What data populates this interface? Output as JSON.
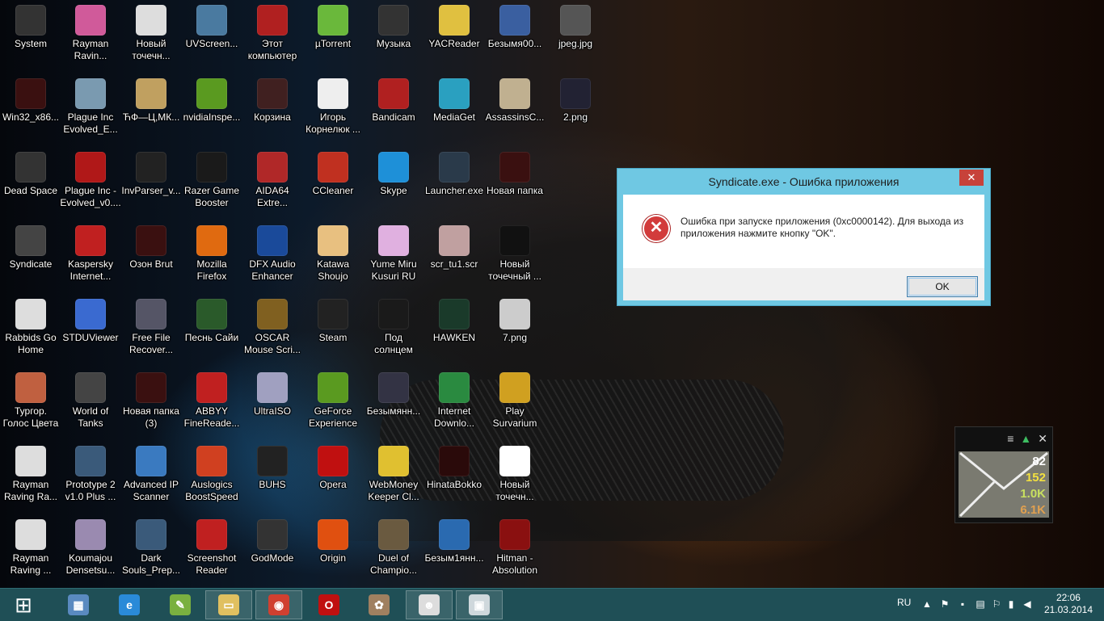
{
  "desktop_icons": [
    {
      "label": "System",
      "icon": "system-icon",
      "color": "#333"
    },
    {
      "label": "Rayman\nRavin...",
      "icon": "rayman-icon",
      "color": "#d05a9a"
    },
    {
      "label": "Новый\nточечн...",
      "icon": "image-file-icon",
      "color": "#ddd"
    },
    {
      "label": "UVScreen...",
      "icon": "screen-recorder-icon",
      "color": "#4a7aa0"
    },
    {
      "label": "Этот\nкомпьютер",
      "icon": "computer-icon",
      "color": "#b02020"
    },
    {
      "label": "µTorrent",
      "icon": "utorrent-icon",
      "color": "#6ab83b"
    },
    {
      "label": "Музыка",
      "icon": "music-folder-icon",
      "color": "#333"
    },
    {
      "label": "YACReader",
      "icon": "speech-bubble-icon",
      "color": "#e0c040"
    },
    {
      "label": "Безымя00...",
      "icon": "image-file-icon",
      "color": "#3a5fa0"
    },
    {
      "label": "jpeg.jpg",
      "icon": "image-file-icon",
      "color": "#555"
    },
    {
      "label": "Win32_x86...",
      "icon": "folder-red-icon",
      "color": "#3a1010"
    },
    {
      "label": "Plague Inc\nEvolved_E...",
      "icon": "plague-icon",
      "color": "#7a9ab0"
    },
    {
      "label": "ЋФ—Ц,МК...",
      "icon": "gear-icon",
      "color": "#c0a060"
    },
    {
      "label": "nvidiaInspe...",
      "icon": "nvidia-icon",
      "color": "#5a9a20"
    },
    {
      "label": "Корзина",
      "icon": "recycle-bin-icon",
      "color": "#402020"
    },
    {
      "label": "Игорь\nКорнелюк ...",
      "icon": "mp3-file-icon",
      "color": "#eee"
    },
    {
      "label": "Bandicam",
      "icon": "bandicam-icon",
      "color": "#b02020"
    },
    {
      "label": "MediaGet",
      "icon": "download-icon",
      "color": "#2aa0c0"
    },
    {
      "label": "AssassinsC...",
      "icon": "assassin-icon",
      "color": "#c0b090"
    },
    {
      "label": "2.png",
      "icon": "image-file-icon",
      "color": "#223"
    },
    {
      "label": "Dead Space",
      "icon": "dead-space-icon",
      "color": "#333"
    },
    {
      "label": "Plague Inc -\nEvolved_v0....",
      "icon": "biohazard-icon",
      "color": "#b01818"
    },
    {
      "label": "InvParser_v...",
      "icon": "letter-a-icon",
      "color": "#222"
    },
    {
      "label": "Razer Game\nBooster",
      "icon": "razer-icon",
      "color": "#1a1a1a"
    },
    {
      "label": "AIDA64\nExtre...",
      "icon": "aida64-icon",
      "color": "#b02828"
    },
    {
      "label": "CCleaner",
      "icon": "ccleaner-icon",
      "color": "#c03020"
    },
    {
      "label": "Skype",
      "icon": "skype-icon",
      "color": "#1e90d8"
    },
    {
      "label": "Launcher.exe",
      "icon": "exe-icon",
      "color": "#2a3a4a"
    },
    {
      "label": "Новая папка",
      "icon": "folder-red-icon",
      "color": "#3a1010"
    },
    {
      "label": "",
      "icon": "",
      "color": ""
    },
    {
      "label": "Syndicate",
      "icon": "syndicate-icon",
      "color": "#444"
    },
    {
      "label": "Kaspersky\nInternet...",
      "icon": "kaspersky-icon",
      "color": "#c02020"
    },
    {
      "label": "Озон Brut",
      "icon": "folder-red-icon",
      "color": "#3a1010"
    },
    {
      "label": "Mozilla\nFirefox",
      "icon": "firefox-icon",
      "color": "#e06a10"
    },
    {
      "label": "DFX Audio\nEnhancer",
      "icon": "dfx-icon",
      "color": "#1a4a9a"
    },
    {
      "label": "Katawa\nShoujo",
      "icon": "heart-icon",
      "color": "#e8c080"
    },
    {
      "label": "Yume Miru\nKusuri RU",
      "icon": "heart-icon",
      "color": "#e0b0e0"
    },
    {
      "label": "scr_tu1.scr",
      "icon": "anime-image-icon",
      "color": "#c0a0a0"
    },
    {
      "label": "Новый\nточечный ...",
      "icon": "image-file-icon",
      "color": "#111"
    },
    {
      "label": "",
      "icon": "",
      "color": ""
    },
    {
      "label": "Rabbids Go\nHome",
      "icon": "rabbids-icon",
      "color": "#ddd"
    },
    {
      "label": "STDUViewer",
      "icon": "magnifier-icon",
      "color": "#3a6ad0"
    },
    {
      "label": "Free File\nRecover...",
      "icon": "film-icon",
      "color": "#556"
    },
    {
      "label": "Песнь Сайи",
      "icon": "eye-icon",
      "color": "#2a5a2a"
    },
    {
      "label": "OSCAR\nMouse Scri...",
      "icon": "oscar-icon",
      "color": "#806020"
    },
    {
      "label": "Steam",
      "icon": "steam-icon",
      "color": "#222"
    },
    {
      "label": "Под\nсолнцем",
      "icon": "folder-red-icon",
      "color": "#1a1a1a"
    },
    {
      "label": "HAWKEN",
      "icon": "hawken-icon",
      "color": "#1a3a2a"
    },
    {
      "label": "7.png",
      "icon": "image-file-icon",
      "color": "#ccc"
    },
    {
      "label": "",
      "icon": "",
      "color": ""
    },
    {
      "label": "Тургор.\nГолос Цвета",
      "icon": "turgor-icon",
      "color": "#c06040"
    },
    {
      "label": "World of\nTanks",
      "icon": "wot-icon",
      "color": "#444"
    },
    {
      "label": "Новая папка\n(3)",
      "icon": "folder-red-icon",
      "color": "#3a1010"
    },
    {
      "label": "ABBYY\nFineReade...",
      "icon": "abbyy-icon",
      "color": "#c02020"
    },
    {
      "label": "UltraISO",
      "icon": "disc-icon",
      "color": "#a0a0c0"
    },
    {
      "label": "GeForce\nExperience",
      "icon": "nvidia-icon",
      "color": "#5a9a20"
    },
    {
      "label": "Безымянн...",
      "icon": "image-file-icon",
      "color": "#334"
    },
    {
      "label": "Internet\nDownlo...",
      "icon": "idm-icon",
      "color": "#2a8a40"
    },
    {
      "label": "Play\nSurvarium",
      "icon": "radiation-icon",
      "color": "#d0a020"
    },
    {
      "label": "",
      "icon": "",
      "color": ""
    },
    {
      "label": "Rayman\nRaving Ra...",
      "icon": "rayman-icon",
      "color": "#ddd"
    },
    {
      "label": "Prototype 2\nv1.0 Plus ...",
      "icon": "trainer-icon",
      "color": "#3a5a7a"
    },
    {
      "label": "Advanced IP\nScanner",
      "icon": "network-icon",
      "color": "#3a7ac0"
    },
    {
      "label": "Auslogics\nBoostSpeed",
      "icon": "speedometer-icon",
      "color": "#d04020"
    },
    {
      "label": "BUHS",
      "icon": "folder-red-icon",
      "color": "#222"
    },
    {
      "label": "Opera",
      "icon": "opera-icon",
      "color": "#c01010"
    },
    {
      "label": "WebMoney\nKeeper Cl...",
      "icon": "webmoney-icon",
      "color": "#e0c030"
    },
    {
      "label": "HinataBokko",
      "icon": "folder-red-icon",
      "color": "#2a0a0a"
    },
    {
      "label": "Новый\nточечн...",
      "icon": "image-file-icon",
      "color": "#fff"
    },
    {
      "label": "",
      "icon": "",
      "color": ""
    },
    {
      "label": "Rayman\nRaving ...",
      "icon": "rayman-icon",
      "color": "#ddd"
    },
    {
      "label": "Koumajou\nDensetsu...",
      "icon": "anime-image-icon",
      "color": "#9a8ab0"
    },
    {
      "label": "Dark\nSouls_Prep...",
      "icon": "trainer-icon",
      "color": "#3a5a7a"
    },
    {
      "label": "Screenshot\nReader",
      "icon": "screenshot-icon",
      "color": "#c02020"
    },
    {
      "label": "GodMode",
      "icon": "godmode-icon",
      "color": "#333"
    },
    {
      "label": "Origin",
      "icon": "origin-icon",
      "color": "#e05010"
    },
    {
      "label": "Duel of\nChampio...",
      "icon": "game-icon",
      "color": "#6a5a40"
    },
    {
      "label": "Безым1янн...",
      "icon": "image-file-icon",
      "color": "#2a6ab0"
    },
    {
      "label": "Hitman -\nAbsolution",
      "icon": "hitman-icon",
      "color": "#8a1010"
    },
    {
      "label": "",
      "icon": "",
      "color": ""
    }
  ],
  "dialog": {
    "title": "Syndicate.exe - Ошибка приложения",
    "close_label": "✕",
    "error_glyph": "✕",
    "message": "Ошибка при запуске приложения (0xc0000142). Для выхода из приложения нажмите кнопку \"OK\".",
    "ok_label": "OK"
  },
  "gadget": {
    "menu_glyph": "≡",
    "up_glyph": "▲",
    "close_glyph": "✕",
    "values": [
      {
        "text": "82",
        "color": "#ffffff"
      },
      {
        "text": "152",
        "color": "#f2e040"
      },
      {
        "text": "1.0K",
        "color": "#c8e060"
      },
      {
        "text": "6.1K",
        "color": "#e0a050"
      }
    ]
  },
  "taskbar": {
    "apps": [
      {
        "name": "taskbar-windows-logo",
        "icon": "windows-logo-icon",
        "glyph": "⊞",
        "color": "transparent",
        "active": false
      },
      {
        "name": "taskbar-calculator",
        "icon": "calculator-icon",
        "glyph": "▦",
        "color": "#5a8ac0",
        "active": false
      },
      {
        "name": "taskbar-internet-explorer",
        "icon": "internet-explorer-icon",
        "glyph": "e",
        "color": "#2a8ad8",
        "active": false
      },
      {
        "name": "taskbar-notepad",
        "icon": "notepad-icon",
        "glyph": "✎",
        "color": "#7ab040",
        "active": false
      },
      {
        "name": "taskbar-file-explorer",
        "icon": "folder-icon",
        "glyph": "▭",
        "color": "#e0c060",
        "active": true
      },
      {
        "name": "taskbar-chrome",
        "icon": "chrome-icon",
        "glyph": "◉",
        "color": "#d04030",
        "active": true
      },
      {
        "name": "taskbar-opera",
        "icon": "opera-icon",
        "glyph": "O",
        "color": "#c01010",
        "active": false
      },
      {
        "name": "taskbar-paint",
        "icon": "paint-palette-icon",
        "glyph": "✿",
        "color": "#a08060",
        "active": false
      },
      {
        "name": "taskbar-rayman",
        "icon": "rayman-icon",
        "glyph": "☻",
        "color": "#ddd",
        "active": true
      },
      {
        "name": "taskbar-error-window",
        "icon": "window-icon",
        "glyph": "▣",
        "color": "#cfd8dc",
        "active": true
      }
    ],
    "lang": "RU",
    "time": "22:06",
    "date": "21.03.2014"
  }
}
